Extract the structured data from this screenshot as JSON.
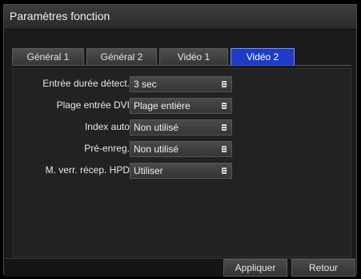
{
  "window": {
    "title": "Paramètres fonction"
  },
  "tabs": [
    {
      "label": "Général 1",
      "active": false
    },
    {
      "label": "Général 2",
      "active": false
    },
    {
      "label": "Vidéo 1",
      "active": false
    },
    {
      "label": "Vidéo 2",
      "active": true
    }
  ],
  "settings": [
    {
      "label": "Entrée durée détect.",
      "value": "3 sec"
    },
    {
      "label": "Plage entrée DVI",
      "value": "Plage entière"
    },
    {
      "label": "Index auto",
      "value": "Non utilisé"
    },
    {
      "label": "Pré-enreg.",
      "value": "Non utilisé"
    },
    {
      "label": "M. verr. récep. HPD",
      "value": "Utiliser"
    }
  ],
  "footer": {
    "apply_label": "Appliquer",
    "back_label": "Retour"
  },
  "colors": {
    "active_tab": "#1f3cc6",
    "background": "#1b1b1b"
  }
}
